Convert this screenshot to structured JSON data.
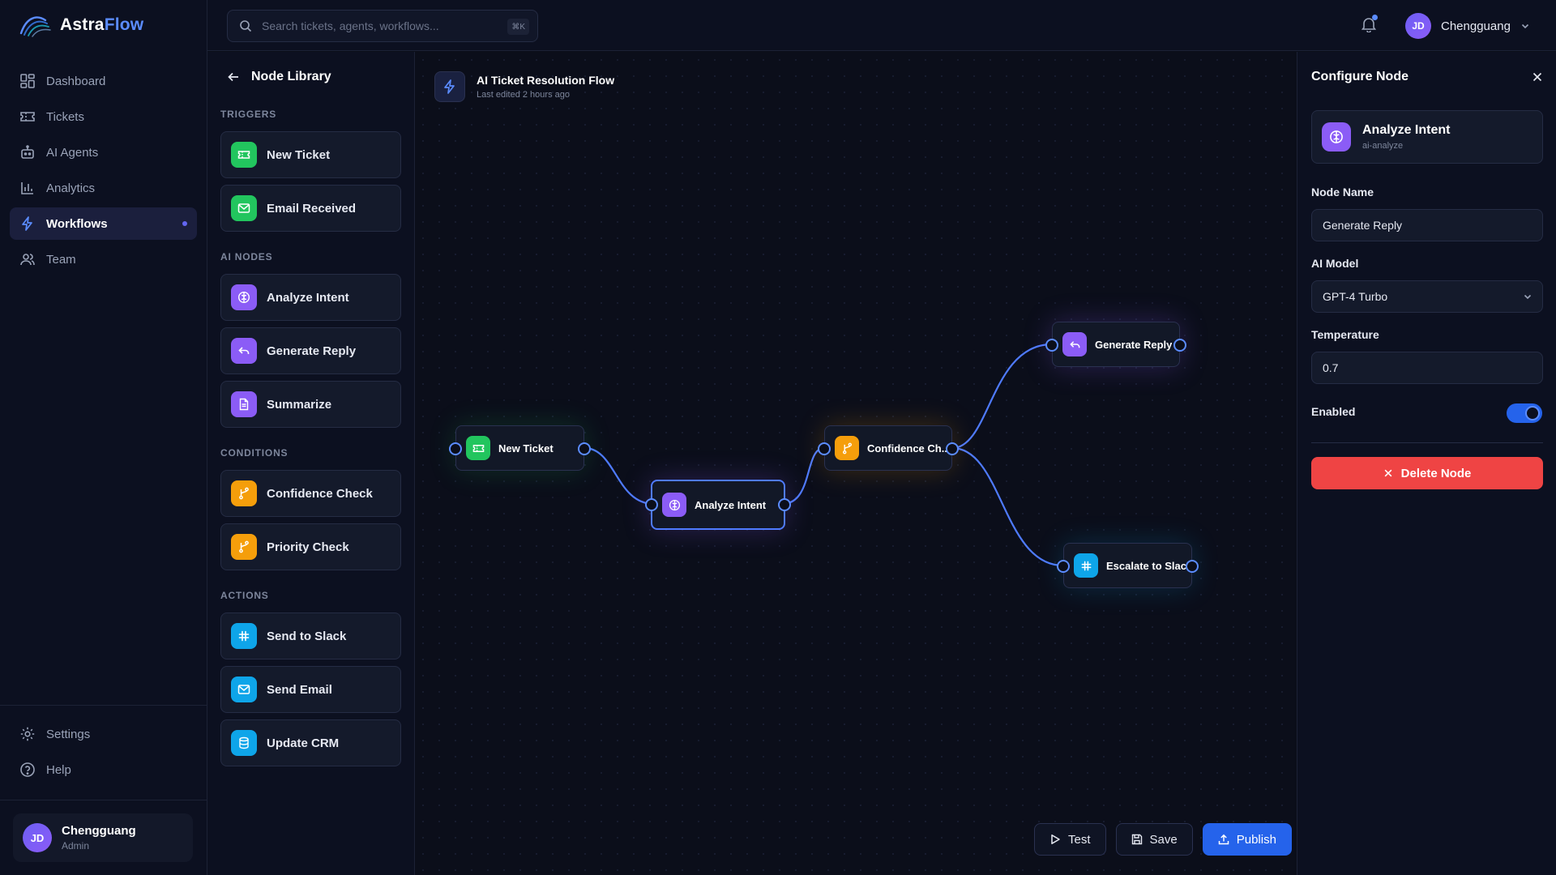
{
  "brand": {
    "name_main": "Astra",
    "name_accent": "Flow"
  },
  "search": {
    "placeholder": "Search tickets, agents, workflows...",
    "shortcut": "⌘K"
  },
  "nav": {
    "items": [
      {
        "label": "Dashboard",
        "icon": "dashboard-icon"
      },
      {
        "label": "Tickets",
        "icon": "ticket-icon"
      },
      {
        "label": "AI Agents",
        "icon": "bot-icon"
      },
      {
        "label": "Analytics",
        "icon": "bar-chart-icon"
      },
      {
        "label": "Workflows",
        "icon": "lightning-icon",
        "active": true
      },
      {
        "label": "Team",
        "icon": "users-icon"
      }
    ],
    "bottom": [
      {
        "label": "Settings",
        "icon": "gear-icon"
      },
      {
        "label": "Help",
        "icon": "help-icon"
      }
    ]
  },
  "user": {
    "initials": "JD",
    "name": "Chengguang",
    "role": "Admin"
  },
  "library": {
    "title": "Node Library",
    "sections": [
      {
        "label": "TRIGGERS",
        "items": [
          "New Ticket",
          "Email Received"
        ]
      },
      {
        "label": "AI NODES",
        "items": [
          "Analyze Intent",
          "Generate Reply",
          "Summarize"
        ]
      },
      {
        "label": "CONDITIONS",
        "items": [
          "Confidence Check",
          "Priority Check"
        ]
      },
      {
        "label": "ACTIONS",
        "items": [
          "Send to Slack",
          "Send Email",
          "Update CRM"
        ]
      }
    ]
  },
  "flow": {
    "title": "AI Ticket Resolution Flow",
    "subtitle": "Last edited 2 hours ago",
    "nodes": [
      {
        "label": "New Ticket",
        "kind": "trigger"
      },
      {
        "label": "Analyze Intent",
        "kind": "ai",
        "selected": true
      },
      {
        "label": "Confidence Ch...",
        "kind": "condition"
      },
      {
        "label": "Generate Reply",
        "kind": "ai"
      },
      {
        "label": "Escalate to Slack",
        "kind": "action"
      }
    ]
  },
  "actions": {
    "test": "Test",
    "save": "Save",
    "publish": "Publish"
  },
  "config": {
    "title": "Configure Node",
    "node_title": "Analyze Intent",
    "node_type": "ai-analyze",
    "name_label": "Node Name",
    "name_value": "Generate Reply",
    "model_label": "AI Model",
    "model_value": "GPT-4 Turbo",
    "temp_label": "Temperature",
    "temp_value": "0.7",
    "enabled_label": "Enabled",
    "enabled": true,
    "delete_label": "Delete Node"
  },
  "colors": {
    "accent": "#5b8cff",
    "trigger": "#22c55e",
    "ai": "#8b5cf6",
    "condition": "#f59e0b",
    "action": "#0ea5e9",
    "danger": "#ef4444",
    "primary": "#2563eb"
  }
}
